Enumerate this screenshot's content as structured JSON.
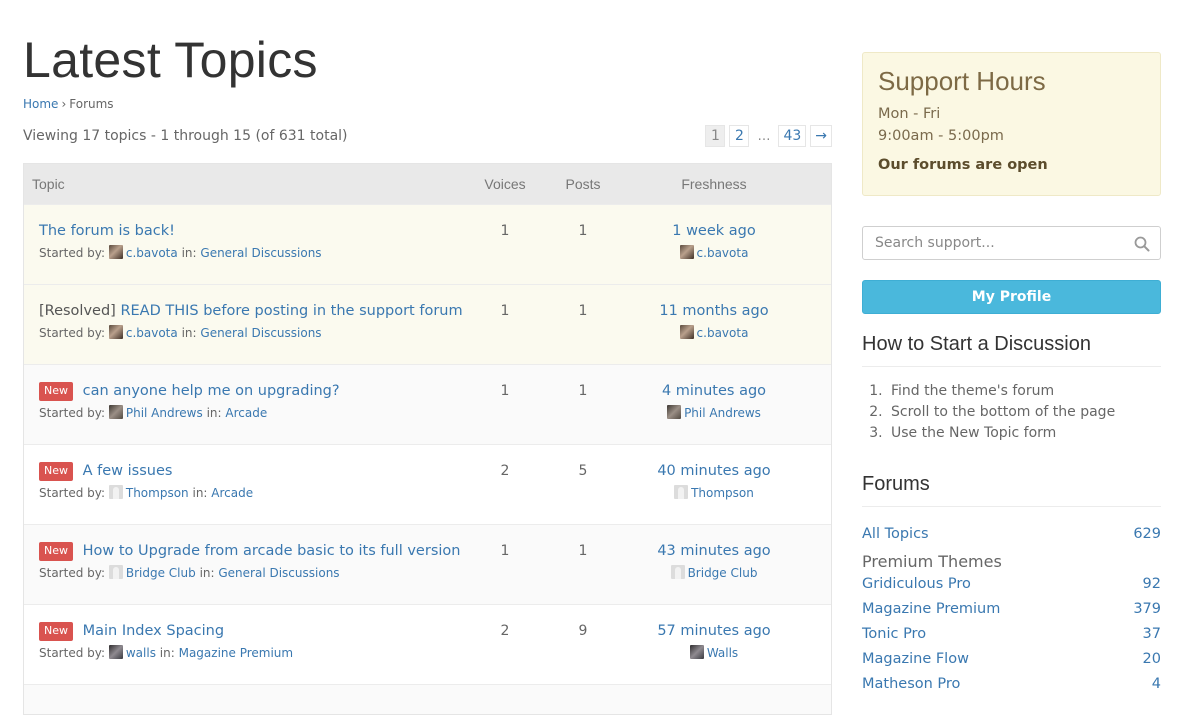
{
  "page": {
    "title": "Latest Topics",
    "breadcrumb": {
      "home": "Home",
      "separator": "›",
      "current": "Forums"
    },
    "viewing": "Viewing 17 topics - 1 through 15 (of 631 total)"
  },
  "pagination": {
    "pages": [
      "1",
      "2",
      "…",
      "43"
    ],
    "current": "1",
    "next": "→"
  },
  "table": {
    "headers": {
      "topic": "Topic",
      "voices": "Voices",
      "posts": "Posts",
      "freshness": "Freshness"
    },
    "started_by_label": "Started by:",
    "in_label": "in:",
    "new_badge": "New",
    "rows": [
      {
        "prefix": "",
        "new": false,
        "sticky": true,
        "title": "The forum is back!",
        "author": "c.bavota",
        "avatar": "photo1",
        "forum": "General Discussions",
        "voices": "1",
        "posts": "1",
        "freshness": "1 week ago",
        "last_user": "c.bavota",
        "last_avatar": "photo1"
      },
      {
        "prefix": "[Resolved]",
        "new": false,
        "sticky": true,
        "title": "READ THIS before posting in the support forum",
        "author": "c.bavota",
        "avatar": "photo1",
        "forum": "General Discussions",
        "voices": "1",
        "posts": "1",
        "freshness": "11 months ago",
        "last_user": "c.bavota",
        "last_avatar": "photo1"
      },
      {
        "prefix": "",
        "new": true,
        "sticky": false,
        "title": "can anyone help me on upgrading?",
        "author": "Phil Andrews",
        "avatar": "photo2",
        "forum": "Arcade",
        "voices": "1",
        "posts": "1",
        "freshness": "4 minutes ago",
        "last_user": "Phil Andrews",
        "last_avatar": "photo2"
      },
      {
        "prefix": "",
        "new": true,
        "sticky": false,
        "title": "A few issues",
        "author": "Thompson",
        "avatar": "default",
        "forum": "Arcade",
        "voices": "2",
        "posts": "5",
        "freshness": "40 minutes ago",
        "last_user": "Thompson",
        "last_avatar": "default"
      },
      {
        "prefix": "",
        "new": true,
        "sticky": false,
        "title": "How to Upgrade from arcade basic to its full version",
        "author": "Bridge Club",
        "avatar": "default",
        "forum": "General Discussions",
        "voices": "1",
        "posts": "1",
        "freshness": "43 minutes ago",
        "last_user": "Bridge Club",
        "last_avatar": "default"
      },
      {
        "prefix": "",
        "new": true,
        "sticky": false,
        "title": "Main Index Spacing",
        "author": "walls",
        "avatar": "photo3",
        "forum": "Magazine Premium",
        "voices": "2",
        "posts": "9",
        "freshness": "57 minutes ago",
        "last_user": "Walls",
        "last_avatar": "photo3"
      }
    ]
  },
  "sidebar": {
    "support_hours": {
      "title": "Support Hours",
      "days": "Mon - Fri",
      "hours": "9:00am - 5:00pm",
      "status": "Our forums are open"
    },
    "search": {
      "placeholder": "Search support...",
      "value": ""
    },
    "profile_button": "My Profile",
    "how_to": {
      "title": "How to Start a Discussion",
      "steps": [
        "Find the theme's forum",
        "Scroll to the bottom of the page",
        "Use the New Topic form"
      ]
    },
    "forums": {
      "title": "Forums",
      "all": {
        "label": "All Topics",
        "count": "629"
      },
      "group": "Premium Themes",
      "items": [
        {
          "label": "Gridiculous Pro",
          "count": "92"
        },
        {
          "label": "Magazine Premium",
          "count": "379"
        },
        {
          "label": "Tonic Pro",
          "count": "37"
        },
        {
          "label": "Magazine Flow",
          "count": "20"
        },
        {
          "label": "Matheson Pro",
          "count": "4"
        }
      ]
    }
  },
  "colors": {
    "link": "#3a78b0",
    "new_badge": "#d9534f",
    "profile_button": "#4ab8dc",
    "support_box": "#fbf8e3",
    "sticky_row": "#fbfaef"
  }
}
